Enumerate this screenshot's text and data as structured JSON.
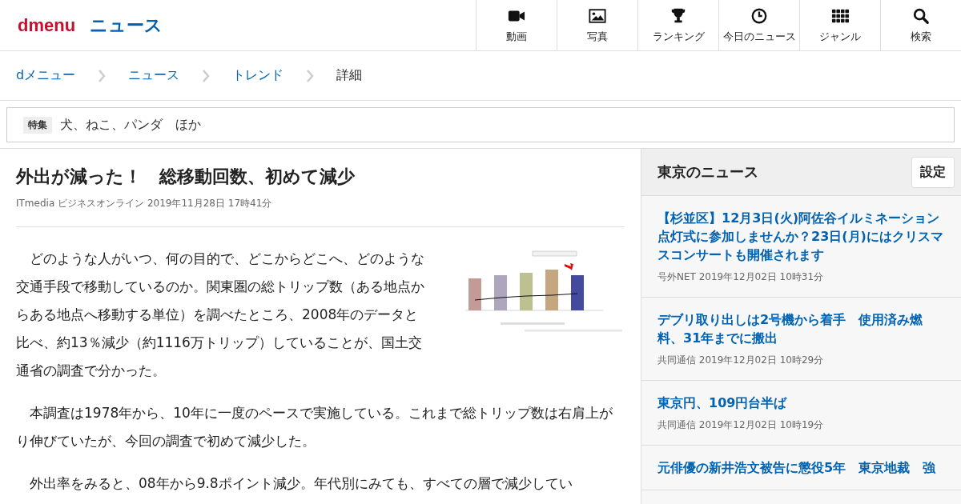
{
  "header": {
    "logo": "dmenu",
    "section": "ニュース",
    "nav": [
      {
        "label": "動画"
      },
      {
        "label": "写真"
      },
      {
        "label": "ランキング"
      },
      {
        "label": "今日のニュース"
      },
      {
        "label": "ジャンル"
      },
      {
        "label": "検索"
      }
    ]
  },
  "breadcrumb": [
    {
      "label": "dメニュー",
      "link": true
    },
    {
      "label": "ニュース",
      "link": true
    },
    {
      "label": "トレンド",
      "link": true
    },
    {
      "label": "詳細",
      "link": false
    }
  ],
  "feature": {
    "tag": "特集",
    "text": "犬、ねこ、パンダ　ほか"
  },
  "article": {
    "title": "外出が減った！　総移動回数、初めて減少",
    "meta": "ITmedia ビジネスオンライン  2019年11月28日  17時41分",
    "figure": {
      "kind": "picture"
    },
    "paragraphs": [
      "　どのような人がいつ、何の目的で、どこからどこへ、どのような交通手段で移動しているのか。関東圏の総トリップ数（ある地点からある地点へ移動する単位）を調べたところ、2008年のデータと比べ、約13％減少（約1116万トリップ）していることが、国土交通省の調査で分かった。",
      "　本調査は1978年から、10年に一度のペースで実施している。これまで総トリップ数は右肩上がり伸びていたが、今回の調査で初めて減少した。",
      "　外出率をみると、08年から9.8ポイント減少。年代別にみても、すべての層で減少してい"
    ]
  },
  "sidebar": {
    "title": "東京のニュース",
    "button": "設定",
    "items": [
      {
        "title": "【杉並区】12月3日(火)阿佐谷イルミネーション点灯式に参加しませんか？23日(月)にはクリスマスコンサートも開催されます",
        "meta": "号外NET  2019年12月02日  10時31分"
      },
      {
        "title": "デブリ取り出しは2号機から着手　使用済み燃料、31年までに搬出",
        "meta": "共同通信  2019年12月02日  10時29分"
      },
      {
        "title": "東京円、109円台半ば",
        "meta": "共同通信  2019年12月02日  10時19分"
      },
      {
        "title": "元俳優の新井浩文被告に懲役5年　東京地裁　強"
      }
    ]
  }
}
